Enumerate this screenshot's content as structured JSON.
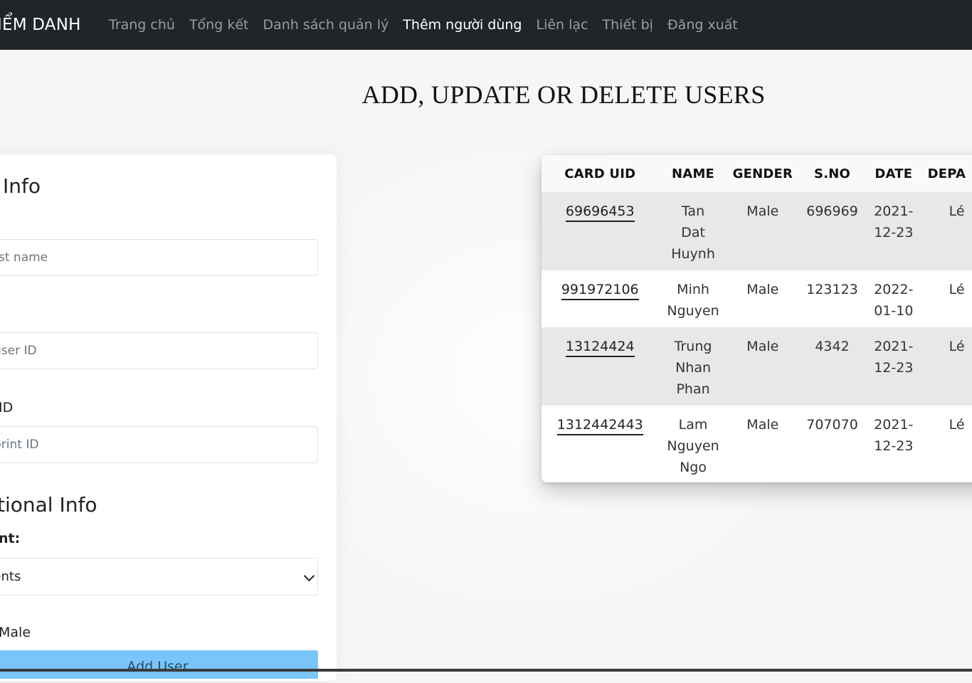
{
  "nav": {
    "brand": "ĐIỂM DANH",
    "links": [
      {
        "label": "Trang chủ",
        "active": false
      },
      {
        "label": "Tổng kết",
        "active": false
      },
      {
        "label": "Danh sách quản lý",
        "active": false
      },
      {
        "label": "Thêm người dùng",
        "active": true
      },
      {
        "label": "Liên lạc",
        "active": false
      },
      {
        "label": "Thiết bị",
        "active": false
      },
      {
        "label": "Đăng xuất",
        "active": false
      }
    ]
  },
  "page": {
    "title": "ADD, UPDATE OR DELETE USERS"
  },
  "form": {
    "user_info_heading": "Info",
    "first_name_placeholder": "rst name",
    "user_id_placeholder": "user ID",
    "fingerprint_label": "ID",
    "fingerprint_placeholder": "print ID",
    "additional_heading": "tional Info",
    "department_label": "nt:",
    "department_value": "nents",
    "gender_label": "Male",
    "add_button": "Add User"
  },
  "table": {
    "headers": [
      "CARD UID",
      "NAME",
      "GENDER",
      "S.NO",
      "DATE",
      "DEPA"
    ],
    "rows": [
      {
        "uid": "69696453",
        "name": [
          "Tan",
          "Dat",
          "Huynh"
        ],
        "gender": "Male",
        "sno": "696969",
        "date": [
          "2021-",
          "12-23"
        ],
        "dept": "Lé"
      },
      {
        "uid": "991972106",
        "name": [
          "Minh",
          "Nguyen"
        ],
        "gender": "Male",
        "sno": "123123",
        "date": [
          "2022-",
          "01-10"
        ],
        "dept": "Lé"
      },
      {
        "uid": "13124424",
        "name": [
          "Trung",
          "Nhan",
          "Phan"
        ],
        "gender": "Male",
        "sno": "4342",
        "date": [
          "2021-",
          "12-23"
        ],
        "dept": "Lé"
      },
      {
        "uid": "1312442443",
        "name": [
          "Lam",
          "Nguyen",
          "Ngo"
        ],
        "gender": "Male",
        "sno": "707070",
        "date": [
          "2021-",
          "12-23"
        ],
        "dept": "Lé"
      }
    ]
  }
}
